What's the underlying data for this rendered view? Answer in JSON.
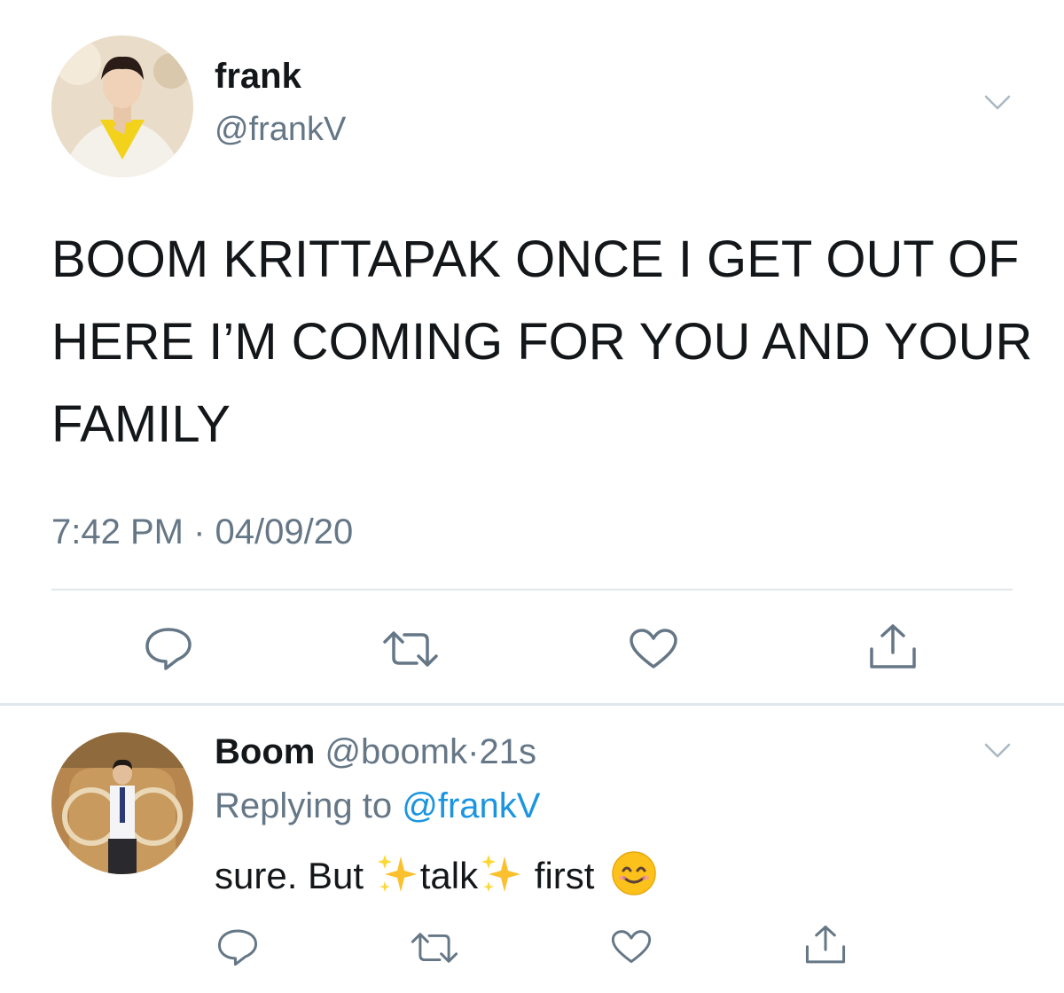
{
  "main_tweet": {
    "display_name": "frank",
    "handle": "@frankV",
    "text": "BOOM KRITTAPAK ONCE I GET OUT OF HERE I’M COMING FOR YOU AND YOUR FAMILY",
    "timestamp": "7:42 PM · 04/09/20"
  },
  "reply": {
    "display_name": "Boom",
    "handle": "@boomk",
    "separator": "·",
    "age": "21s",
    "replying_to_prefix": "Replying to ",
    "replying_to_handle": "@frankV",
    "text_part1": "sure. But ",
    "text_part2": "talk",
    "text_part3": " first ",
    "emojis": [
      "sparkles-icon",
      "sparkles-icon",
      "smiling-face-icon"
    ]
  },
  "actions": [
    "reply-icon",
    "retweet-icon",
    "like-icon",
    "share-icon"
  ],
  "colors": {
    "text": "#14171a",
    "secondary": "#657786",
    "link": "#1b95e0",
    "divider": "#e1e8ed",
    "icon": "#657786"
  }
}
